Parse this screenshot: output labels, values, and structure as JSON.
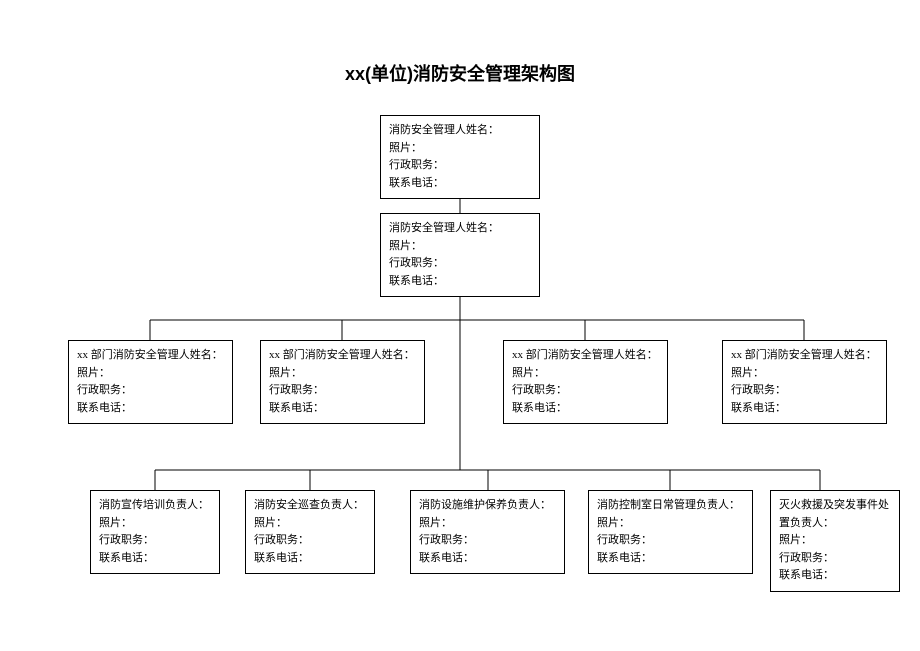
{
  "title": "xx(单位)消防安全管理架构图",
  "top1": {
    "line1": "消防安全管理人姓名：",
    "line2": "照片：",
    "line3": "行政职务：",
    "line4": "联系电话："
  },
  "top2": {
    "line1": "消防安全管理人姓名：",
    "line2": "照片：",
    "line3": "行政职务：",
    "line4": "联系电话："
  },
  "dept": [
    {
      "line1": "xx 部门消防安全管理人姓名：",
      "line2": "照片：",
      "line3": "行政职务：",
      "line4": "联系电话："
    },
    {
      "line1": "xx 部门消防安全管理人姓名：",
      "line2": "照片：",
      "line3": "行政职务：",
      "line4": "联系电话："
    },
    {
      "line1": "xx 部门消防安全管理人姓名：",
      "line2": "照片：",
      "line3": "行政职务：",
      "line4": "联系电话："
    },
    {
      "line1": "xx 部门消防安全管理人姓名：",
      "line2": "照片：",
      "line3": "行政职务：",
      "line4": "联系电话："
    }
  ],
  "role": [
    {
      "line1": "消防宣传培训负责人：",
      "line2": "照片：",
      "line3": "行政职务：",
      "line4": "联系电话：",
      "line5": ""
    },
    {
      "line1": "消防安全巡查负责人：",
      "line2": "照片：",
      "line3": "行政职务：",
      "line4": "联系电话：",
      "line5": ""
    },
    {
      "line1": "消防设施维护保养负责人：",
      "line2": "照片：",
      "line3": "行政职务：",
      "line4": "联系电话：",
      "line5": ""
    },
    {
      "line1": "消防控制室日常管理负责人：",
      "line2": "照片：",
      "line3": "行政职务：",
      "line4": "联系电话：",
      "line5": ""
    },
    {
      "line1": "灭火救援及突发事件处",
      "line2": "置负责人：",
      "line3": "照片：",
      "line4": "行政职务：",
      "line5": "联系电话："
    }
  ]
}
